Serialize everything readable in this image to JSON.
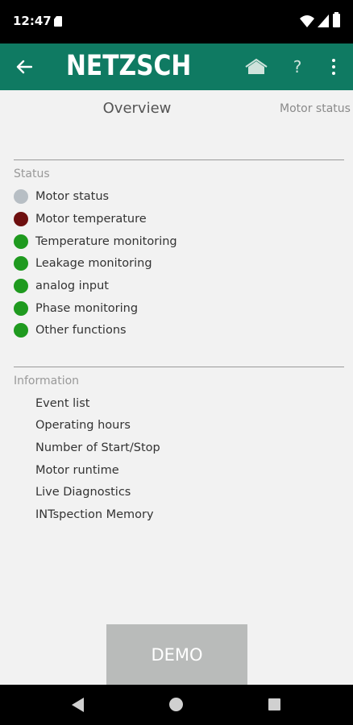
{
  "status_bar": {
    "time": "12:47"
  },
  "app_bar": {
    "brand": "NETZSCH",
    "help_label": "?",
    "accent_color": "#0f7a62"
  },
  "tabs": [
    {
      "label": "Overview"
    },
    {
      "label": "Motor status"
    }
  ],
  "status": {
    "title": "Status",
    "items": [
      {
        "label": "Motor status",
        "color": "#b7bec4"
      },
      {
        "label": "Motor temperature",
        "color": "#6e0f0f"
      },
      {
        "label": "Temperature monitoring",
        "color": "#1f9a1f"
      },
      {
        "label": "Leakage monitoring",
        "color": "#1f9a1f"
      },
      {
        "label": "analog input",
        "color": "#1f9a1f"
      },
      {
        "label": "Phase monitoring",
        "color": "#1f9a1f"
      },
      {
        "label": "Other functions",
        "color": "#1f9a1f"
      }
    ]
  },
  "information": {
    "title": "Information",
    "items": [
      {
        "label": "Event list"
      },
      {
        "label": "Operating hours"
      },
      {
        "label": "Number of Start/Stop"
      },
      {
        "label": "Motor runtime"
      },
      {
        "label": "Live Diagnostics"
      },
      {
        "label": "INTspection Memory"
      }
    ]
  },
  "demo": {
    "label": "DEMO"
  }
}
